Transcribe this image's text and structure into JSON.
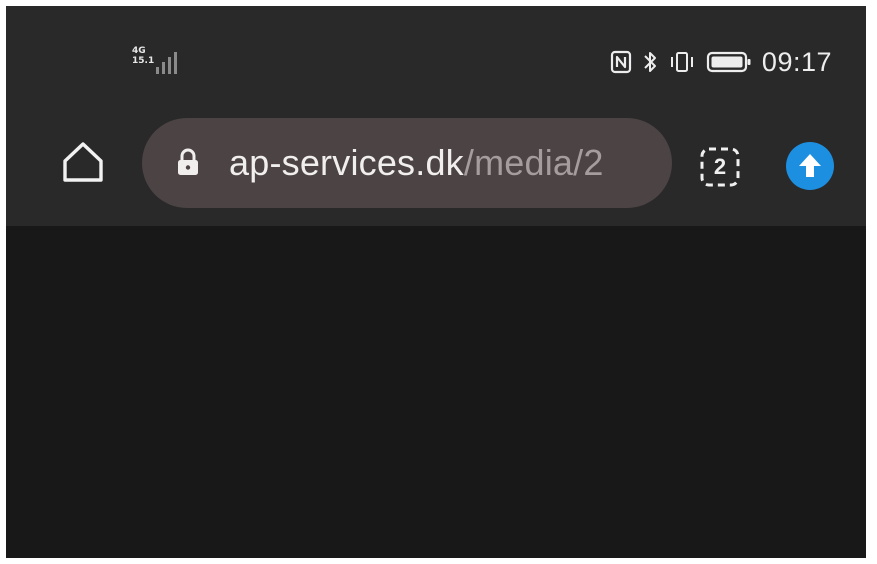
{
  "status_bar": {
    "network_type": "4G",
    "network_sub": "15.1",
    "signal_icon": "cellular-signal-icon",
    "nfc_icon": "nfc-icon",
    "bluetooth_icon": "bluetooth-icon",
    "vibrate_icon": "vibrate-icon",
    "battery_icon": "battery-icon",
    "time": "09:17"
  },
  "toolbar": {
    "home_icon": "home-icon",
    "lock_icon": "lock-icon",
    "url_host": "ap-services.dk",
    "url_path": "/media/2",
    "tab_count": "2",
    "update_icon": "arrow-up-icon"
  },
  "colors": {
    "chrome_background": "#29292a",
    "page_background": "#181819",
    "url_bar": "#4c4344",
    "update_accent": "#1d8fe0"
  }
}
